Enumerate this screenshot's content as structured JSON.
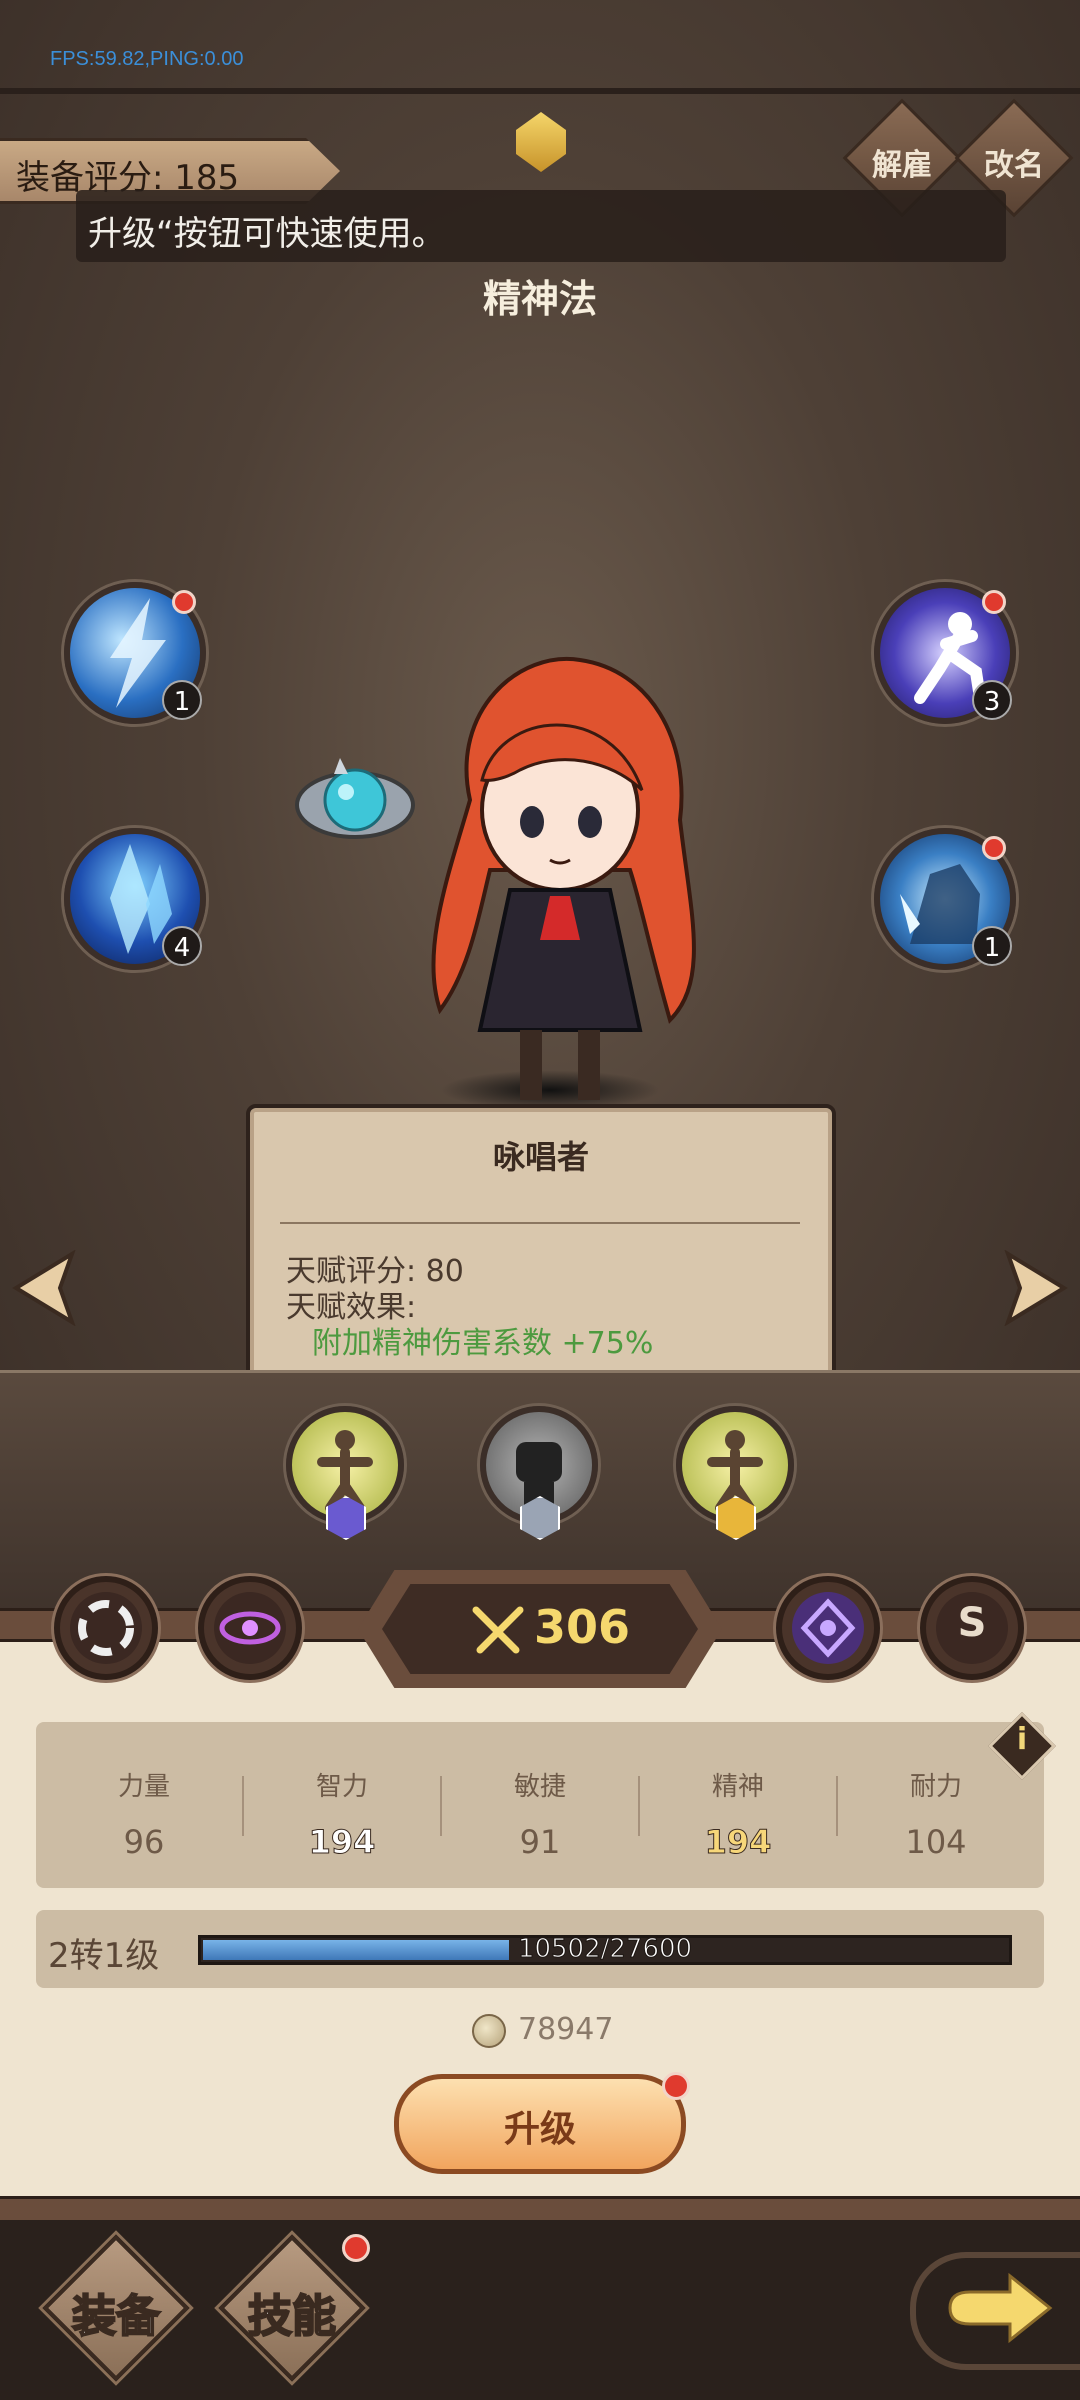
{
  "debug": {
    "fps_text": "FPS:59.82,PING:0.00"
  },
  "header": {
    "score_label": "装备评分: 185",
    "dismiss_label": "解雇",
    "rename_label": "改名",
    "tip_text": "升级“按钮可快速使用。",
    "class_name": "精神法"
  },
  "skills": {
    "left": [
      {
        "icon": "lightning-skill-icon",
        "level": "1",
        "has_alert": true
      },
      {
        "icon": "ice-shard-skill-icon",
        "level": "4",
        "has_alert": false
      }
    ],
    "right": [
      {
        "icon": "dash-skill-icon",
        "level": "3",
        "has_alert": true
      },
      {
        "icon": "frost-beast-skill-icon",
        "level": "1",
        "has_alert": true
      }
    ]
  },
  "talent": {
    "name": "咏唱者",
    "score_line": "天赋评分: 80",
    "effect_title": "天赋效果:",
    "effect_text": "附加精神伤害系数 +75%"
  },
  "runes": [
    {
      "icon": "figure-rune-icon",
      "gem": "purple-gem-icon",
      "gem_color": "#6a5ad0"
    },
    {
      "icon": "fist-rune-icon",
      "gem": "silver-gem-icon",
      "gem_color": "#9aa4b4"
    },
    {
      "icon": "figure-rune-icon",
      "gem": "gold-gem-icon",
      "gem_color": "#e8b63a"
    }
  ],
  "power": {
    "value": "306"
  },
  "tabs": {
    "s_label": "S"
  },
  "stats": [
    {
      "label": "力量",
      "value": "96",
      "style": "normal"
    },
    {
      "label": "智力",
      "value": "194",
      "style": "hi"
    },
    {
      "label": "敏捷",
      "value": "91",
      "style": "normal"
    },
    {
      "label": "精神",
      "value": "194",
      "style": "gold"
    },
    {
      "label": "耐力",
      "value": "104",
      "style": "normal"
    }
  ],
  "level": {
    "label": "2转1级",
    "xp_text": "10502/27600",
    "xp_fraction": 0.3805
  },
  "currency": {
    "amount": "78947"
  },
  "upgrade": {
    "label": "升级"
  },
  "bottom_nav": {
    "equip_label": "装备",
    "skill_label": "技能"
  },
  "colors": {
    "accent_gold": "#f5d86e",
    "alert_red": "#e03a2e",
    "talent_green": "#4d9a3f"
  }
}
